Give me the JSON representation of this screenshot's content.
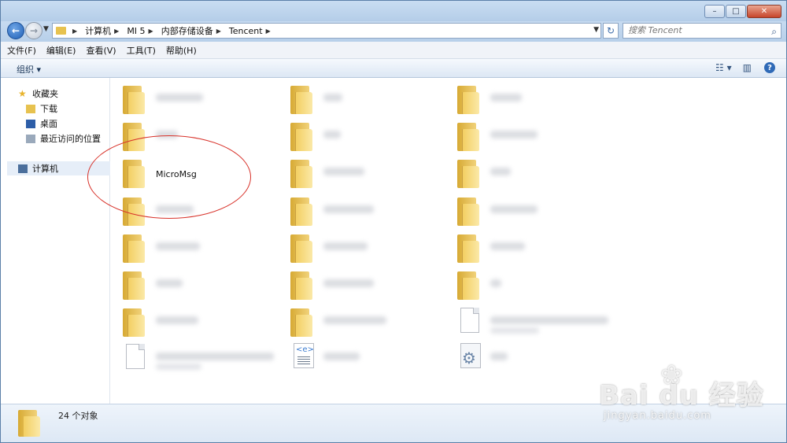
{
  "titlebar": {
    "minimize": "–",
    "maximize": "□",
    "close": "✕"
  },
  "navbar": {
    "back_glyph": "←",
    "forward_glyph": "→",
    "breadcrumb": [
      "计算机",
      "MI 5",
      "内部存储设备",
      "Tencent"
    ],
    "refresh_glyph": "↻",
    "search_placeholder": "搜索 Tencent",
    "search_icon": "search-icon"
  },
  "menubar": [
    "文件(F)",
    "编辑(E)",
    "查看(V)",
    "工具(T)",
    "帮助(H)"
  ],
  "toolbar": {
    "organize_label": "组织 ▾",
    "help_glyph": "?"
  },
  "sidebar": {
    "favorites_label": "收藏夹",
    "items": [
      {
        "label": "下载",
        "icon": "downloads-icon"
      },
      {
        "label": "桌面",
        "icon": "desktop-icon"
      },
      {
        "label": "最近访问的位置",
        "icon": "recent-places-icon"
      }
    ],
    "computer_label": "计算机"
  },
  "content": {
    "visible_item_label": "MicroMsg",
    "item_count": 24
  },
  "statusbar": {
    "text": "24 个对象"
  },
  "watermark": {
    "brand": "Bai du 经验",
    "url": "jingyan.baidu.com"
  },
  "colors": {
    "annotation_circle": "#d8322a",
    "folder": "#f3cf62",
    "accent": "#2f6ab7"
  }
}
